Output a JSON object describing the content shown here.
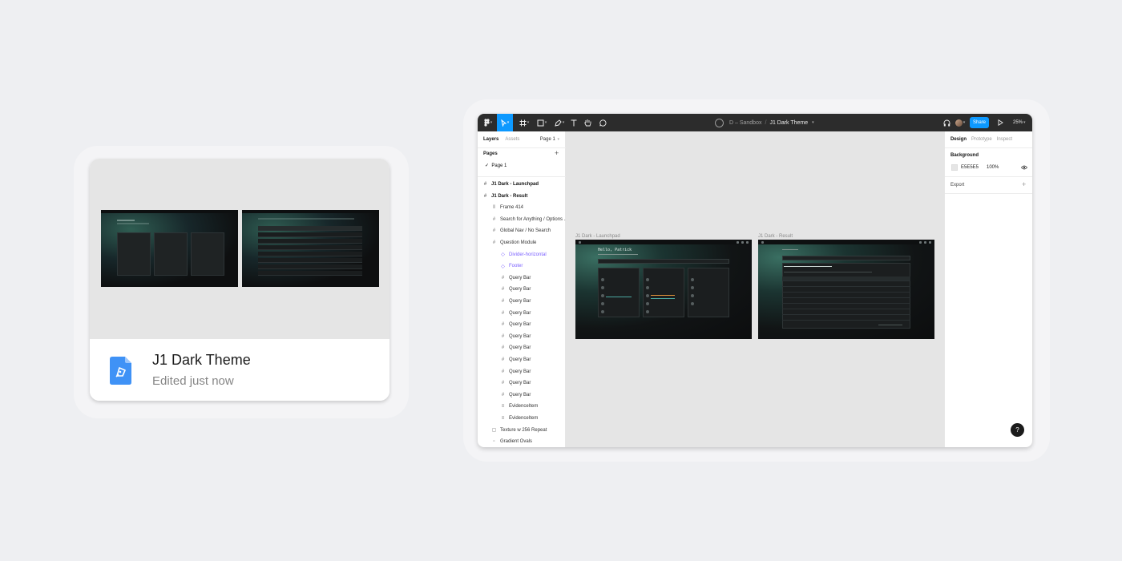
{
  "file_card": {
    "title": "J1 Dark Theme",
    "subtitle": "Edited just now"
  },
  "toolbar": {
    "tools": [
      "figma-menu-icon",
      "move-icon",
      "frame-icon",
      "shape-icon",
      "pen-icon",
      "text-icon",
      "hand-icon",
      "comment-icon"
    ],
    "team": "D – Sandbox",
    "separator": "/",
    "file_name": "J1 Dark Theme",
    "share_label": "Share",
    "zoom": "25%",
    "accent": "#0d99ff"
  },
  "layers_panel": {
    "tabs": [
      "Layers",
      "Assets"
    ],
    "page_selector": "Page 1",
    "pages_header": "Pages",
    "pages": [
      "Page 1"
    ],
    "layers": [
      {
        "label": "J1 Dark - Launchpad",
        "type": "frame",
        "indent": 0
      },
      {
        "label": "J1 Dark - Result",
        "type": "frame",
        "indent": 0
      },
      {
        "label": "Frame 414",
        "type": "autolayout",
        "indent": 1
      },
      {
        "label": "Search for Anything / Options ...",
        "type": "frame",
        "indent": 1
      },
      {
        "label": "Global Nav / No Search",
        "type": "frame",
        "indent": 1
      },
      {
        "label": "Question Module",
        "type": "frame",
        "indent": 1
      },
      {
        "label": "Divider-horizontal",
        "type": "component",
        "indent": 2
      },
      {
        "label": "Footer",
        "type": "component",
        "indent": 2
      },
      {
        "label": "Query Bar",
        "type": "frame",
        "indent": 2
      },
      {
        "label": "Query Bar",
        "type": "frame",
        "indent": 2
      },
      {
        "label": "Query Bar",
        "type": "frame",
        "indent": 2
      },
      {
        "label": "Query Bar",
        "type": "frame",
        "indent": 2
      },
      {
        "label": "Query Bar",
        "type": "frame",
        "indent": 2
      },
      {
        "label": "Query Bar",
        "type": "frame",
        "indent": 2
      },
      {
        "label": "Query Bar",
        "type": "frame",
        "indent": 2
      },
      {
        "label": "Query Bar",
        "type": "frame",
        "indent": 2
      },
      {
        "label": "Query Bar",
        "type": "frame",
        "indent": 2
      },
      {
        "label": "Query Bar",
        "type": "frame",
        "indent": 2
      },
      {
        "label": "Query Bar",
        "type": "frame",
        "indent": 2
      },
      {
        "label": "EvidenceItem",
        "type": "text-frame",
        "indent": 2
      },
      {
        "label": "EvidenceItem",
        "type": "text-frame",
        "indent": 2
      },
      {
        "label": "Texture w 256 Repeat",
        "type": "image",
        "indent": 1
      },
      {
        "label": "Gradient Ovals",
        "type": "group",
        "indent": 1
      }
    ]
  },
  "canvas": {
    "frames": [
      {
        "label": "J1 Dark - Launchpad",
        "greeting": "Hello, Patrick"
      },
      {
        "label": "J1 Dark - Result"
      }
    ]
  },
  "design_panel": {
    "tabs": [
      "Design",
      "Prototype",
      "Inspect"
    ],
    "background_header": "Background",
    "background_hex": "E5E5E5",
    "background_opacity": "100%",
    "export_header": "Export",
    "help_label": "?"
  }
}
